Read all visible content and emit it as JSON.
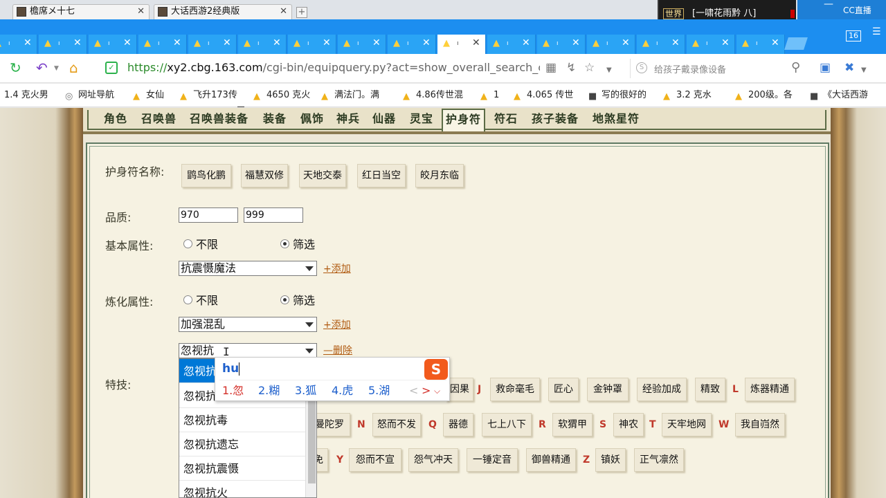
{
  "os": {
    "tabs": [
      {
        "title": "檐席メ十七"
      },
      {
        "title": "大话西游2经典版"
      }
    ],
    "plus": "+",
    "game_panel": {
      "world": "世界",
      "text": "[一啸花雨黔 八]"
    },
    "window_controls": {
      "minimize": "—",
      "brand": "CC直播"
    }
  },
  "browser": {
    "tab_count": "16",
    "tab_close": "✕",
    "url_proto": "https://",
    "url_host": "xy2.cbg.163.com",
    "url_path": "/cgi-bin/equipquery.py?act=show_overall_search_ch",
    "search_placeholder": "给孩子戴录像设备",
    "bookmarks": [
      {
        "label": "1.4 克火男",
        "icon": "none"
      },
      {
        "label": "网址导航",
        "icon": "globe"
      },
      {
        "label": "女仙",
        "icon": "chick"
      },
      {
        "label": "飞升173传",
        "icon": "chick"
      },
      {
        "label": "4650 克火",
        "icon": "chick"
      },
      {
        "label": "满法门。满",
        "icon": "chick"
      },
      {
        "label": "4.86传世混",
        "icon": "chick"
      },
      {
        "label": "1",
        "icon": "chick"
      },
      {
        "label": "4.065 传世",
        "icon": "chick"
      },
      {
        "label": "写的很好的",
        "icon": "img"
      },
      {
        "label": "3.2    克水",
        "icon": "chick"
      },
      {
        "label": "200级。各",
        "icon": "chick"
      },
      {
        "label": "《大话西游",
        "icon": "img"
      }
    ]
  },
  "nav_tabs": [
    "角色",
    "召唤兽",
    "召唤兽装备",
    "装备",
    "佩饰",
    "神兵",
    "仙器",
    "灵宝",
    "护身符",
    "符石",
    "孩子装备",
    "地煞星符"
  ],
  "form": {
    "amulet_name_label": "护身符名称:",
    "amulet_names": [
      "鹍鸟化鹏",
      "福慧双修",
      "天地交泰",
      "红日当空",
      "皎月东临"
    ],
    "quality_label": "品质:",
    "quality_min": "970",
    "quality_max": "999",
    "basic_attr_label": "基本属性:",
    "refine_attr_label": "炼化属性:",
    "radio_unlimited": "不限",
    "radio_filter": "筛选",
    "basic_select": "抗震慑魔法",
    "refine_select_1": "加强混乱",
    "refine_select_2": "忽视抗",
    "add_link": "+添加",
    "delete_link": "—删除",
    "skill_label": "特技:"
  },
  "skills": {
    "row1": [
      "因果",
      "J",
      "救命毫毛",
      "匠心",
      "金钟罩",
      "经验加成",
      "精致",
      "L",
      "炼器精通"
    ],
    "row2": [
      "曼陀罗",
      "N",
      "怒而不发",
      "Q",
      "器德",
      "七上八下",
      "R",
      "软猬甲",
      "S",
      "神农",
      "T",
      "天牢地网",
      "W",
      "我自岿然"
    ],
    "row3": [
      "免",
      "Y",
      "怨而不宣",
      "怨气冲天",
      "一锤定音",
      "御兽精通",
      "Z",
      "镇妖",
      "正气凛然"
    ]
  },
  "dropdown": {
    "items": [
      "忽视抗",
      "忽视抗",
      "忽视抗毒",
      "忽视抗遗忘",
      "忽视抗震慑",
      "忽视抗火"
    ]
  },
  "ime": {
    "composition": "hu",
    "logo": "S",
    "candidates": [
      "1.忽",
      "2.糊",
      "3.狐",
      "4.虎",
      "5.湖"
    ],
    "prev": "<",
    "next": ">",
    "expand": "⌵"
  },
  "colors": {
    "tabstrip": "#1c8ef0",
    "selection": "#0078d7",
    "link": "#b05a10",
    "letter": "#c0392b",
    "ime_blue": "#1d5fcc",
    "ime_red": "#d4302a"
  }
}
